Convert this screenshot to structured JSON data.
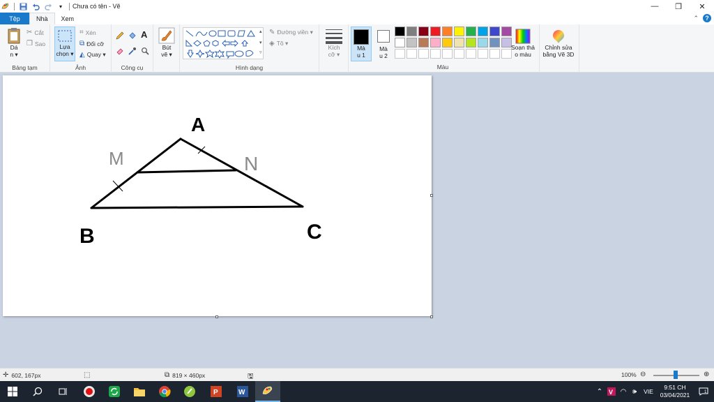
{
  "window": {
    "title": "Chưa có tên - Vẽ",
    "controls": [
      "—",
      "❐",
      "✕"
    ]
  },
  "tabs": [
    {
      "label": "Tệp"
    },
    {
      "label": "Nhà"
    },
    {
      "label": "Xem"
    }
  ],
  "ribbon": {
    "clipboard": {
      "paste_l1": "Dá",
      "paste_l2": "n ▾",
      "cut": "Cắt",
      "copy": "Sao",
      "label": "Bảng tạm"
    },
    "image": {
      "select_l1": "Lựa",
      "select_l2": "chọn ▾",
      "crop": "Xén",
      "resize": "Đổi cỡ",
      "rotate": "Quay ▾",
      "label": "Ảnh"
    },
    "tools": {
      "text_icon": "A",
      "label": "Công cụ"
    },
    "brushes": {
      "l1": "Bút",
      "l2": "vẽ ▾"
    },
    "shapes": {
      "outline": "Đường viền ▾",
      "fill": "Tô ▾",
      "label": "Hình dạng"
    },
    "size": {
      "l1": "Kích",
      "l2": "cỡ ▾"
    },
    "color1": {
      "l1": "Mà",
      "l2": "u 1",
      "value": "#000000"
    },
    "color2": {
      "l1": "Mà",
      "l2": "u 2",
      "value": "#ffffff"
    },
    "edit_colors": {
      "l1": "Soạn thả",
      "l2": "o màu"
    },
    "paint3d": {
      "l1": "Chỉnh sửa",
      "l2": "bằng Vẽ 3D"
    },
    "colors_label": "Màu",
    "palette": [
      "#000000",
      "#7f7f7f",
      "#880015",
      "#ed1c24",
      "#ff7f27",
      "#fff200",
      "#22b14c",
      "#00a2e8",
      "#3f48cc",
      "#a349a4",
      "#ffffff",
      "#c3c3c3",
      "#b97a57",
      "#ffaec9",
      "#ffc90e",
      "#efe4b0",
      "#b5e61d",
      "#99d9ea",
      "#7092be",
      "#c8bfe7",
      "",
      "",
      "",
      "",
      "",
      "",
      "",
      "",
      "",
      ""
    ]
  },
  "drawing": {
    "labels": {
      "A": "A",
      "M": "M",
      "N": "N",
      "B": "B",
      "C": "C"
    }
  },
  "status": {
    "cursor": "602, 167px",
    "canvas_size": "819 × 460px",
    "zoom": "100%"
  },
  "taskbar": {
    "language": "VIE",
    "time": "9:51 CH",
    "date": "03/04/2021"
  }
}
